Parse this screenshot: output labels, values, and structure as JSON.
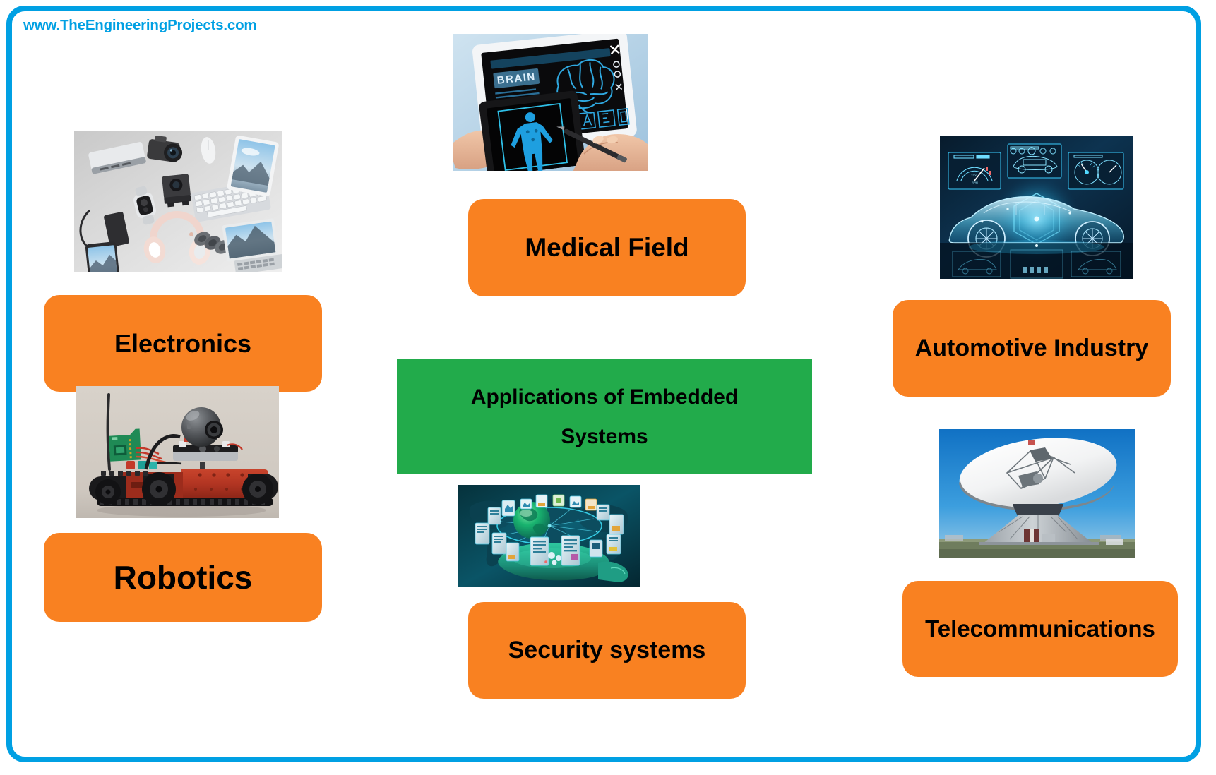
{
  "page": {
    "watermark": "www.TheEngineeringProjects.com",
    "frame_color": "#00a0e3",
    "background": "#ffffff"
  },
  "center": {
    "box_color": "#22ab4b",
    "title_line_1": "Applications of Embedded",
    "title_line_2": "Systems"
  },
  "label_color": "#f98121",
  "items": [
    {
      "key": "electronics",
      "label": "Electronics",
      "image_name": "electronics-gadgets-photo",
      "image_caption": "Assorted consumer electronics flat lay: laptop, cameras, keyboard, headphones, smartwatch, phone, tablets"
    },
    {
      "key": "robotics",
      "label": "Robotics",
      "image_name": "tracked-robot-photo",
      "image_caption": "Red tracked robot with camera dome, antenna and circuit board"
    },
    {
      "key": "medical",
      "label": "Medical Field",
      "image_name": "medical-tablet-photo",
      "image_caption": "Hands using tablets showing a brain scan labelled BRAIN and a blue human body diagram",
      "screen_label": "BRAIN"
    },
    {
      "key": "automotive",
      "label": "Automotive Industry",
      "image_name": "holographic-car-photo",
      "image_caption": "Blue holographic wireframe car surrounded by heads-up dashboard panels"
    },
    {
      "key": "security",
      "label": "Security systems",
      "image_name": "network-cloud-photo",
      "image_caption": "Hand holding a glowing globe with servers and data icons over a world map"
    },
    {
      "key": "telecom",
      "label": "Telecommunications",
      "image_name": "satellite-dish-photo",
      "image_caption": "Large white satellite dish antenna against a blue sky"
    }
  ]
}
